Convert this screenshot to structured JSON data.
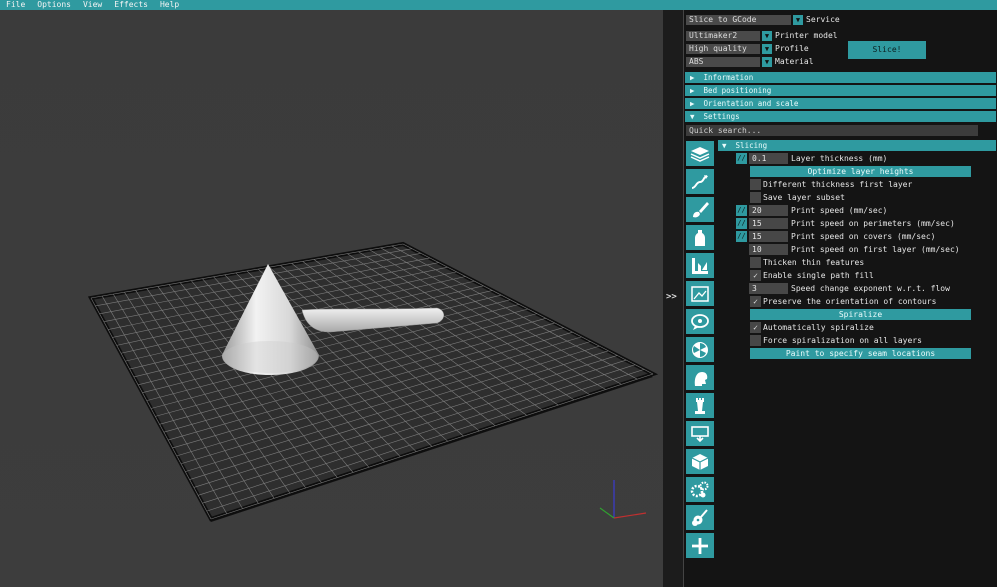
{
  "menu": [
    "File",
    "Options",
    "View",
    "Effects",
    "Help"
  ],
  "sidebar": {
    "expand_toggle": ">>",
    "service": {
      "value": "Slice to GCode",
      "label": "Service"
    },
    "printer_model": {
      "value": "Ultimaker2",
      "label": "Printer model"
    },
    "profile": {
      "value": "High quality",
      "label": "Profile"
    },
    "material": {
      "value": "ABS",
      "label": "Material"
    },
    "slice_button": "Slice!",
    "sections": [
      "Information",
      "Bed positioning",
      "Orientation and scale",
      "Settings"
    ],
    "quick_search_placeholder": "Quick search...",
    "category_icons": [
      "layers-icon",
      "path-icon",
      "brush-icon",
      "bottle-icon",
      "infill-icon",
      "perimeter-icon",
      "speech-icon",
      "fan-icon",
      "head-icon",
      "tower-icon",
      "support-icon",
      "cube-icon",
      "gears-icon",
      "guitar-icon",
      "plus-icon"
    ],
    "slicing": {
      "title": "Slicing",
      "layer_thickness": {
        "value": "0.1",
        "label": "Layer thickness (mm)"
      },
      "optimize_button": "Optimize layer heights",
      "different_thickness": "Different thickness first layer",
      "save_layer_subset": "Save layer subset",
      "print_speed": {
        "value": "20",
        "label": "Print speed (mm/sec)"
      },
      "print_speed_perimeters": {
        "value": "15",
        "label": "Print speed on perimeters (mm/sec)"
      },
      "print_speed_covers": {
        "value": "15",
        "label": "Print speed on covers (mm/sec)"
      },
      "print_speed_first": {
        "value": "10",
        "label": "Print speed on first layer (mm/sec)"
      },
      "thicken_thin": "Thicken thin features",
      "enable_single_path": "Enable single path fill",
      "speed_change_exponent": {
        "value": "3",
        "label": "Speed change exponent w.r.t. flow"
      },
      "preserve_orientation": "Preserve the orientation of contours",
      "spiralize_button": "Spiralize",
      "auto_spiralize": "Automatically spiralize",
      "force_spiralization": "Force spiralization on all layers",
      "paint_seam_button": "Paint to specify seam locations"
    }
  },
  "colors": {
    "accent": "#2f9aa0",
    "panel_bg": "#141414",
    "viewport_bg": "#3c3c3c"
  }
}
